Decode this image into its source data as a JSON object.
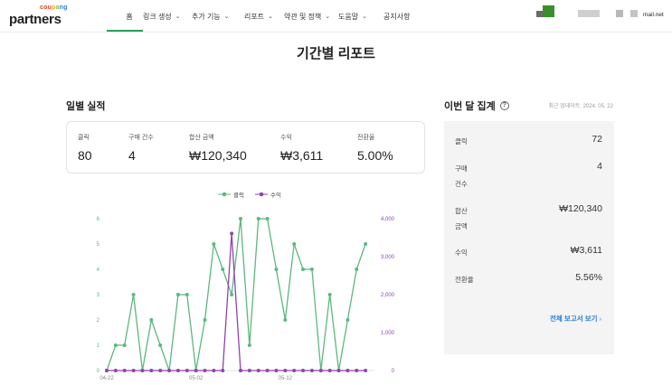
{
  "logo": {
    "small": [
      "cou",
      "p",
      "a",
      "ng"
    ],
    "main": "partners"
  },
  "nav": [
    {
      "label": "홈",
      "dropdown": false,
      "active": true
    },
    {
      "label": "링크 생성",
      "dropdown": true,
      "active": false
    },
    {
      "label": "추가 기능",
      "dropdown": true,
      "active": false
    },
    {
      "label": "리포트",
      "dropdown": true,
      "active": false
    },
    {
      "label": "약관 및 정책",
      "dropdown": true,
      "active": false
    },
    {
      "label": "도움말",
      "dropdown": true,
      "active": false
    },
    {
      "label": "공지사항",
      "dropdown": false,
      "active": false
    }
  ],
  "user": {
    "email_suffix": "mail.net"
  },
  "page_title": "기간별 리포트",
  "daily": {
    "title": "일별 실적",
    "stats": [
      {
        "label": "클릭",
        "value": "80"
      },
      {
        "label": "구매 건수",
        "value": "4"
      },
      {
        "label": "합산 금액",
        "value": "₩120,340"
      },
      {
        "label": "수익",
        "value": "₩3,611"
      },
      {
        "label": "전환율",
        "value": "5.00%"
      }
    ]
  },
  "monthly": {
    "title": "이번 달 집계",
    "updated": "최근 업데이트: 2024. 05. 22",
    "rows": [
      {
        "label": "클릭",
        "value": "72"
      },
      {
        "label": "구매\n건수",
        "value": "4"
      },
      {
        "label": "합산\n금액",
        "value": "₩120,340"
      },
      {
        "label": "수익",
        "value": "₩3,611"
      },
      {
        "label": "전환율",
        "value": "5.56%"
      }
    ],
    "link": "전체 보고서 보기"
  },
  "chart_data": {
    "type": "line",
    "x": [
      "04-22",
      "04-23",
      "04-24",
      "04-25",
      "04-26",
      "04-27",
      "04-28",
      "04-29",
      "04-30",
      "05-01",
      "05-02",
      "05-03",
      "05-04",
      "05-05",
      "05-06",
      "05-07",
      "05-08",
      "05-09",
      "05-10",
      "05-11",
      "05-12",
      "05-13",
      "05-14",
      "05-15",
      "05-16",
      "05-17",
      "05-18",
      "05-19",
      "05-20",
      "05-21",
      "05-22"
    ],
    "x_tick_labels": [
      "04-22",
      "05-02",
      "05-12"
    ],
    "series": [
      {
        "name": "클릭",
        "axis": "left",
        "color": "#5cb87f",
        "values": [
          0,
          1,
          1,
          3,
          0,
          2,
          1,
          0,
          3,
          3,
          0,
          2,
          5,
          4,
          3,
          6,
          1,
          6,
          6,
          4,
          2,
          5,
          4,
          4,
          0,
          3,
          0,
          2,
          4,
          5,
          null
        ]
      },
      {
        "name": "수익",
        "axis": "right",
        "color": "#8e44ad",
        "values": [
          0,
          0,
          0,
          0,
          0,
          0,
          0,
          0,
          0,
          0,
          0,
          0,
          0,
          0,
          3611,
          0,
          0,
          0,
          0,
          0,
          0,
          0,
          0,
          0,
          0,
          0,
          0,
          0,
          0,
          0,
          null
        ]
      }
    ],
    "left_axis": {
      "ylim": [
        0,
        6
      ],
      "ticks": [
        "0",
        "1",
        "2",
        "3",
        "4",
        "5",
        "6"
      ]
    },
    "right_axis": {
      "ylim": [
        0,
        4000
      ],
      "ticks": [
        "0",
        "1,000",
        "2,000",
        "3,000",
        "4,000"
      ]
    },
    "grid": false,
    "legend": "top-center"
  }
}
